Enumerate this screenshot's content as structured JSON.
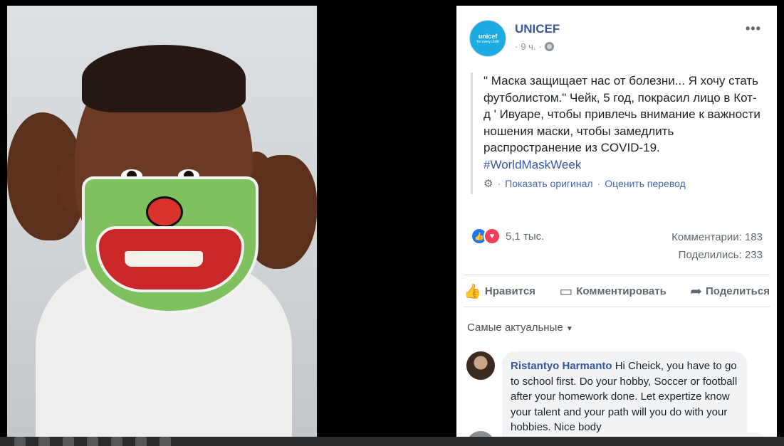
{
  "post": {
    "page_name": "UNICEF",
    "avatar_text": "unicef",
    "avatar_sub": "for every child",
    "time": "9 ч.",
    "more": "•••",
    "text": "\" Маска защищает нас от болезни... Я хочу стать футболистом.\" Чейк, 5 год, покрасил лицо в Кот-д ' Ивуаре, чтобы привлечь внимание к важности ношения маски, чтобы замедлить распространение из COVID-19.",
    "hashtag": "#WorldMaskWeek",
    "show_original": "Показать оригинал",
    "rate_translation": "Оценить перевод"
  },
  "reactions": {
    "count": "5,1 тыс.",
    "comments": "Комментарии: 183",
    "shares": "Поделились: 233"
  },
  "actions": {
    "like": "Нравится",
    "comment": "Комментировать",
    "share": "Поделиться"
  },
  "comments": {
    "sort_label": "Самые актуальные",
    "items": [
      {
        "author": "Ristantyo Harmanto",
        "text": "Hi Cheick, you have to go to school first. Do your hobby, Soccer or football after your homework done. Let expertize know your talent and your path will you do with your hobbies. Nice body"
      }
    ]
  }
}
